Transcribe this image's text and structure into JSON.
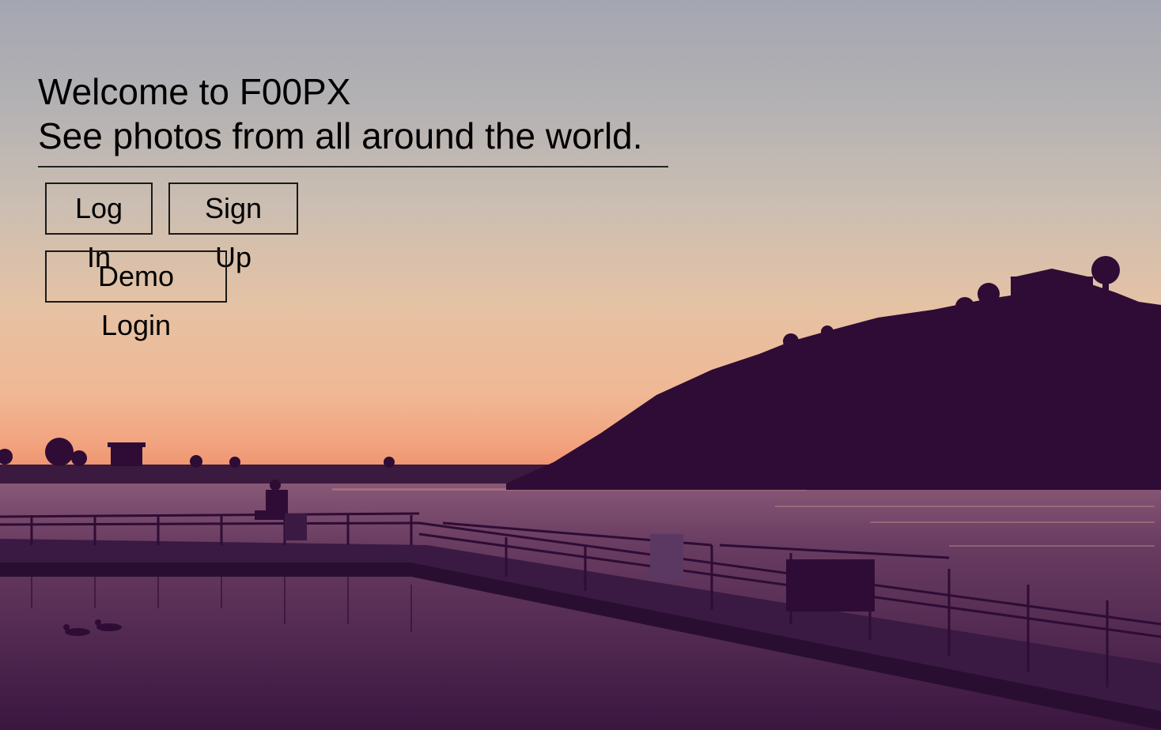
{
  "welcome": {
    "title": "Welcome to F00PX",
    "subtitle": "See photos from all around the world."
  },
  "auth": {
    "login_label": "Log In",
    "signup_label": "Sign Up",
    "demo_label": "Demo Login"
  },
  "colors": {
    "sky_top": "#a4a6b2",
    "sky_horizon": "#ee9470",
    "silhouette": "#2e0c35",
    "water": "#4a2450"
  }
}
